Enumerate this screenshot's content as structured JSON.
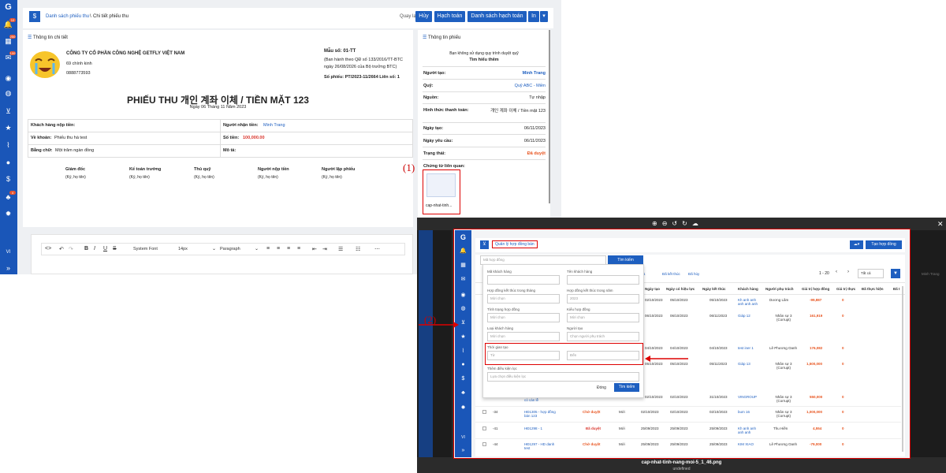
{
  "header": {
    "icon": "dollar-icon",
    "breadcrumb_link": "Danh sách phiếu thu",
    "breadcrumb_sep": "\\",
    "breadcrumb_current": "Chi tiết phiếu thu",
    "back": "Quay lại",
    "btn_cancel": "Hủy",
    "btn_account": "Hạch toán",
    "btn_list": "Danh sách hạch toán",
    "btn_print": "In"
  },
  "sidebar": {
    "lang": "VI",
    "badges": [
      "10",
      "250",
      "100",
      "4"
    ]
  },
  "detail": {
    "section": "Thông tin chi tiết",
    "company": "CÔNG TY CỔ PHẦN CÔNG NGHỆ GETFLY VIỆT NAM",
    "address": "69 chính kinh",
    "phone": "0888773593",
    "form_no": "Mẫu số: 01-TT",
    "decree_1": "(Ban hành theo QĐ số 133/2016/TT-BTC",
    "decree_2": "ngày 26/08/2026 của Bộ trưởng BTC)",
    "voucher_no": "Số phiếu: PT/2023-11/2664 Liên số: 1",
    "title": "PHIẾU THU 개인 계좌 이체 / TIỀN MẶT 123",
    "date": "Ngày 06 Tháng 11 Năm 2023",
    "payer_label": "Khách hàng nộp tiền:",
    "receiver_label": "Người nhận tiền:",
    "receiver": "Minh Trang",
    "reason_label": "Về khoản:",
    "reason": "Phiếu thu hà test",
    "amount_label": "Số tiền:",
    "amount": "100,000.00",
    "words_label": "Bằng chữ:",
    "words": "Một trăm ngàn đồng",
    "desc_label": "Mô tả:",
    "signers": [
      {
        "role": "Giám đốc",
        "hint": "(Ký, họ tên)"
      },
      {
        "role": "Kế toán trưởng",
        "hint": "(Ký, họ tên)"
      },
      {
        "role": "Thủ quỹ",
        "hint": "(Ký, họ tên)"
      },
      {
        "role": "Người nộp tiền",
        "hint": "(Ký, họ tên)"
      },
      {
        "role": "Người lập phiếu",
        "hint": "(Ký, họ tên)"
      }
    ]
  },
  "editor": {
    "font": "System Font",
    "size": "14px",
    "block": "Paragraph"
  },
  "info": {
    "section": "Thông tin phiếu",
    "notice": "Bạn không sử dụng quy trình duyệt quỹ",
    "learn": "Tìm hiểu thêm",
    "rows": [
      {
        "label": "Người tạo:",
        "value": "Minh Trang"
      },
      {
        "label": "Quỹ:",
        "value": "Quỹ ABC - Miền"
      },
      {
        "label": "Nguồn:",
        "value": "Tự nhập"
      },
      {
        "label": "Hình thức thanh toán:",
        "value": "개인 계좌 이체 / Tiền mặt 123"
      },
      {
        "label": "Ngày tạo:",
        "value": "06/11/2023"
      },
      {
        "label": "Ngày yêu cầu:",
        "value": "06/11/2023"
      },
      {
        "label": "Trạng thái:",
        "value": "Đã duyệt"
      }
    ],
    "attach_label": "Chứng từ liên quan:",
    "attach_name": "cap-nhat-tinh..."
  },
  "annotations": {
    "one": "(1)",
    "two": "(2)"
  },
  "viewer": {
    "filename": "cap-nhat-tinh-nang-moi-5_1_46.png",
    "sub": "undefined",
    "page_tab": "Quản lý hợp đồng bán",
    "search_ph": "Mã hợp đồng",
    "search_btn": "Tìm kiếm",
    "create_btn": "Tạo hợp đồng",
    "pager": "1 - 20",
    "per_page": "Tất cả",
    "tabs": [
      "1",
      "Đã kết thúc",
      "Đã hủy"
    ],
    "filter": [
      {
        "label": "Mã khách hàng",
        "value": ""
      },
      {
        "label": "Tên khách hàng",
        "value": ""
      },
      {
        "label": "Hợp đồng kết thúc trong tháng",
        "value": "Mời chọn"
      },
      {
        "label": "Hợp đồng kết thúc trong năm",
        "value": "2023"
      },
      {
        "label": "Tình trạng hợp đồng",
        "value": "Mời chọn"
      },
      {
        "label": "Kiểu hợp đồng",
        "value": "Mời chọn"
      },
      {
        "label": "Loại khách hàng",
        "value": "Mời chọn"
      },
      {
        "label": "Người tạo",
        "value": "Chọn người phụ trách"
      }
    ],
    "time_label": "Thời gian tạo",
    "from": "Từ",
    "to": "Đến",
    "extra_label": "Thêm điều kiện lọc",
    "extra_ph": "Lựa chọn điều kiện lọc",
    "close": "Đóng",
    "find": "Tìm kiếm",
    "cols": [
      "Ngày tạo",
      "Ngày có hiệu lực",
      "Ngày kết thúc",
      "Khách hàng",
      "Người phụ trách",
      "Giá trị hợp đồng",
      "Giá trị thực",
      "Đã thực hiện",
      "Đã t"
    ],
    "rows": [
      {
        "id": "",
        "code": "",
        "status": "",
        "type": "",
        "d1": "02/10/2023",
        "d2": "05/10/2023",
        "d3": "05/10/2023",
        "cust": "Kh anh anh anh anh anh",
        "owner": "Dương Lâm",
        "value": "-99,887",
        "real": "0"
      },
      {
        "id": "",
        "code": "",
        "status": "",
        "type": "",
        "d1": "06/10/2023",
        "d2": "06/10/2023",
        "d3": "06/11/2023",
        "cust": "Giáp 12",
        "owner": "Nhân sự 3 (Corrupt)",
        "value": "161,919",
        "real": "0"
      },
      {
        "id": "",
        "code": "",
        "status": "",
        "type": "",
        "d1": "04/10/2023",
        "d2": "04/10/2023",
        "d3": "04/10/2023",
        "cust": "test iner 1",
        "owner": "Lê Phương Oanh",
        "value": "176,082",
        "real": "0"
      },
      {
        "id": "",
        "code": "",
        "status": "",
        "type": "",
        "d1": "05/10/2023",
        "d2": "05/10/2023",
        "d3": "05/11/2023",
        "cust": "Giáp 13",
        "owner": "Nhân sự 3 (Corrupt)",
        "value": "1,500,000",
        "real": "0"
      },
      {
        "id": "",
        "code": "có cán lễ",
        "status": "",
        "type": "",
        "d1": "02/10/2023",
        "d2": "02/10/2023",
        "d3": "31/10/2023",
        "cust": "VINGROUP",
        "owner": "Nhân sự 3 (Corrupt)",
        "value": "550,000",
        "real": "0"
      },
      {
        "id": "-34",
        "code": "HĐ1305 - hợp đồng bán 123",
        "status": "Chờ duyệt",
        "type": "Mới",
        "d1": "02/10/2023",
        "d2": "02/10/2023",
        "d3": "02/10/2023",
        "cust": "bum 16",
        "owner": "Nhân sự 3 (Corrupt)",
        "value": "1,000,000",
        "real": "0"
      },
      {
        "id": "-41",
        "code": "HĐ1298 - 1",
        "status": "Đã duyệt",
        "type": "Mới",
        "d1": "25/09/2023",
        "d2": "25/09/2023",
        "d3": "25/09/2023",
        "cust": "Kh anh anh anh anh",
        "owner": "Thu Hiền",
        "value": "4,554",
        "real": "0"
      },
      {
        "id": "-44",
        "code": "HĐ1297 - HD danh test",
        "status": "Chờ duyệt",
        "type": "Mới",
        "d1": "25/09/2023",
        "d2": "25/09/2023",
        "d3": "25/09/2023",
        "cust": "KIM XIAO",
        "owner": "Lê Phương Oanh",
        "value": "-79,000",
        "real": "0"
      }
    ],
    "right_peek": "Minh Trang"
  }
}
